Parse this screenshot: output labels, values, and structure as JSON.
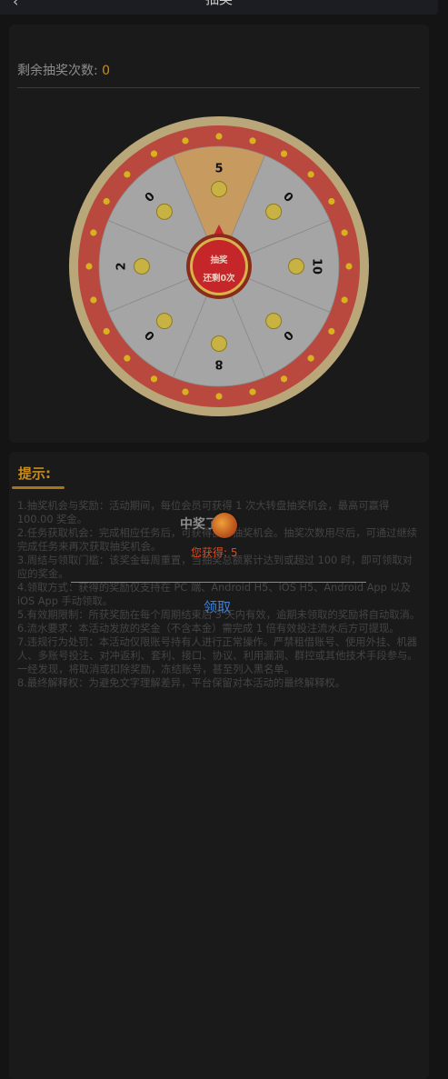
{
  "header": {
    "title": "抽奖",
    "back_glyph": "‹"
  },
  "lottery": {
    "remaining_label": "剩余抽奖次数:",
    "remaining_count": "0",
    "prizes": [
      "5",
      "0",
      "10",
      "0",
      "8",
      "0",
      "2",
      "0"
    ],
    "center_label": "抽奖",
    "center_sub": "还剩0次",
    "colors": {
      "rim": "#b9a77a",
      "ring": "#b9493e",
      "dot": "#d7b21e",
      "slice": "#a5a5a5",
      "highlight": "#c79a60",
      "center": "#c4262a"
    }
  },
  "tips": {
    "title": "提示:",
    "rules": [
      "1.抽奖机会与奖励：活动期间，每位会员可获得 1 次大转盘抽奖机会，最高可赢得 100.00 奖金。",
      "2.任务获取机会：完成相应任务后，可获得额外抽奖机会。抽奖次数用尽后，可通过继续完成任务来再次获取抽奖机会。",
      "3.周结与领取门槛：该奖金每周重置，当抽奖总额累计达到或超过 100 时，即可领取对应的奖金。",
      "4.领取方式：获得的奖励仅支持在 PC 端、Android H5、iOS H5、Android App 以及 iOS App 手动领取。",
      "5.有效期限制：所获奖励在每个周期结束后 3 天内有效，逾期未领取的奖励将自动取消。",
      "6.流水要求：本活动发放的奖金（不含本金）需完成 1 倍有效投注流水后方可提现。",
      "7.违规行为处罚：本活动仅限账号持有人进行正常操作。严禁租借账号、使用外挂、机器人、多账号投注、对冲返利、套利、接口、协议、利用漏洞、群控或其他技术手段参与。一经发现，将取消或扣除奖励，冻结账号，甚至列入黑名单。",
      "8.最终解释权：为避免文字理解差异，平台保留对本活动的最终解释权。"
    ]
  },
  "popup": {
    "title": "中奖了！",
    "result_prefix": "您获得:",
    "result_value": "5",
    "claim_label": "领取"
  }
}
